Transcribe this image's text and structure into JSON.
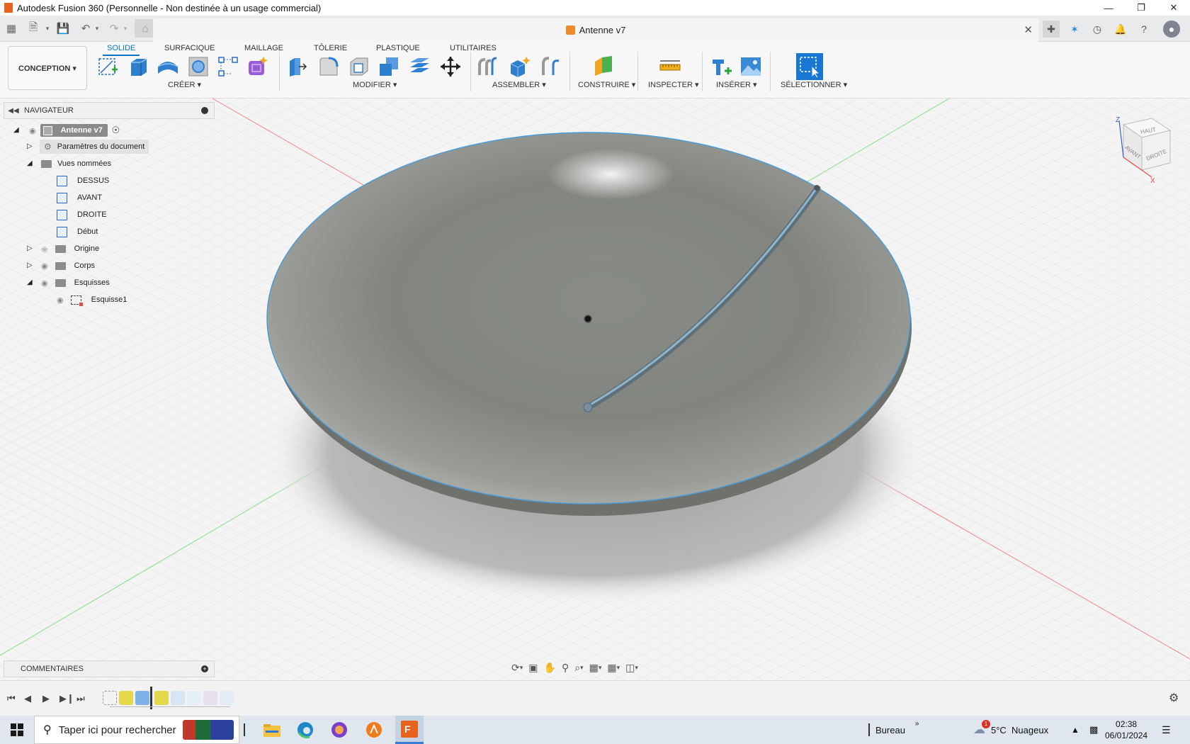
{
  "window": {
    "title": "Autodesk Fusion 360 (Personnelle - Non destinée à un usage commercial)",
    "controls": [
      "minimize",
      "restore",
      "close"
    ]
  },
  "appbar": {
    "document_tab": "Antenne v7"
  },
  "toolbar": {
    "workspace": "CONCEPTION ▾",
    "tabs": [
      "SOLIDE",
      "SURFACIQUE",
      "MAILLAGE",
      "TÔLERIE",
      "PLASTIQUE",
      "UTILITAIRES"
    ],
    "active_tab": "SOLIDE",
    "groups": [
      "CRÉER ▾",
      "MODIFIER ▾",
      "ASSEMBLER ▾",
      "CONSTRUIRE ▾",
      "INSPECTER ▾",
      "INSÉRER ▾",
      "SÉLECTIONNER ▾"
    ]
  },
  "navigator": {
    "title": "NAVIGATEUR",
    "root": "Antenne v7",
    "items": [
      {
        "label": "Paramètres du document"
      },
      {
        "label": "Vues nommées"
      },
      {
        "label": "DESSUS"
      },
      {
        "label": "AVANT"
      },
      {
        "label": "DROITE"
      },
      {
        "label": "Début"
      },
      {
        "label": "Origine"
      },
      {
        "label": "Corps"
      },
      {
        "label": "Esquisses"
      },
      {
        "label": "Esquisse1"
      }
    ]
  },
  "viewcube": {
    "faces": [
      "HAUT",
      "AVANT",
      "DROITE"
    ],
    "axes": [
      "Z",
      "X"
    ]
  },
  "comments": {
    "title": "COMMENTAIRES"
  },
  "taskbar": {
    "search_placeholder": "Taper ici pour rechercher",
    "desktop_label": "Bureau",
    "weather": "5°C  Nuageux",
    "time": "02:38",
    "date": "06/01/2024",
    "notification_badge": "1"
  },
  "colors": {
    "accent": "#0b74c4",
    "brand_orange": "#e8641c",
    "canvas_bg": "#f3f3f3"
  }
}
